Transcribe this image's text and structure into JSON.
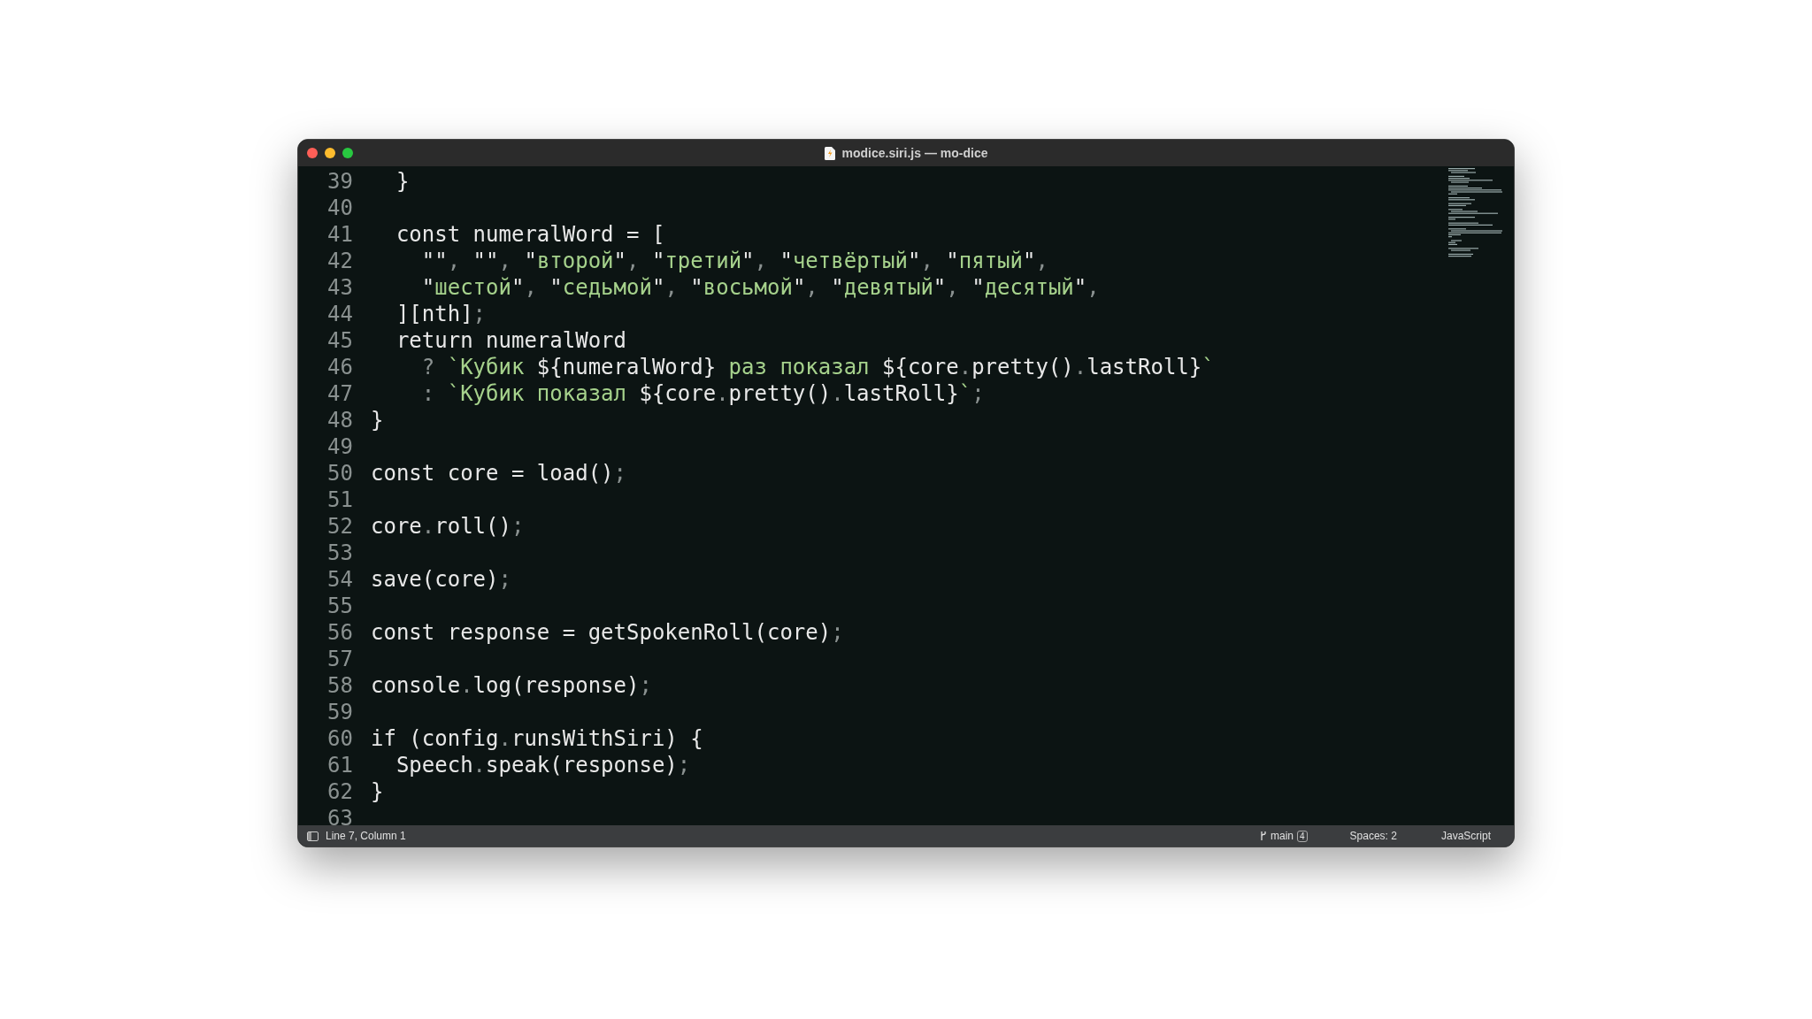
{
  "window": {
    "title": "modice.siri.js — mo-dice"
  },
  "editor": {
    "lines": [
      {
        "number": "39",
        "tokens": [
          {
            "kind": "plain",
            "text": "  }"
          }
        ]
      },
      {
        "number": "40"
      },
      {
        "number": "41",
        "tokens": [
          {
            "kind": "plain",
            "text": "  const numeralWord = ["
          }
        ]
      },
      {
        "number": "42",
        "tokens": [
          {
            "kind": "plain",
            "text": "    \"\""
          },
          {
            "kind": "punct",
            "text": ", "
          },
          {
            "kind": "plain",
            "text": "\"\""
          },
          {
            "kind": "punct",
            "text": ", "
          },
          {
            "kind": "plain",
            "text": "\""
          },
          {
            "kind": "string",
            "text": "второй"
          },
          {
            "kind": "plain",
            "text": "\""
          },
          {
            "kind": "punct",
            "text": ", "
          },
          {
            "kind": "plain",
            "text": "\""
          },
          {
            "kind": "string",
            "text": "третий"
          },
          {
            "kind": "plain",
            "text": "\""
          },
          {
            "kind": "punct",
            "text": ", "
          },
          {
            "kind": "plain",
            "text": "\""
          },
          {
            "kind": "string",
            "text": "четвёртый"
          },
          {
            "kind": "plain",
            "text": "\""
          },
          {
            "kind": "punct",
            "text": ", "
          },
          {
            "kind": "plain",
            "text": "\""
          },
          {
            "kind": "string",
            "text": "пятый"
          },
          {
            "kind": "plain",
            "text": "\""
          },
          {
            "kind": "punct",
            "text": ","
          }
        ]
      },
      {
        "number": "43",
        "tokens": [
          {
            "kind": "plain",
            "text": "    \""
          },
          {
            "kind": "string",
            "text": "шестой"
          },
          {
            "kind": "plain",
            "text": "\""
          },
          {
            "kind": "punct",
            "text": ", "
          },
          {
            "kind": "plain",
            "text": "\""
          },
          {
            "kind": "string",
            "text": "седьмой"
          },
          {
            "kind": "plain",
            "text": "\""
          },
          {
            "kind": "punct",
            "text": ", "
          },
          {
            "kind": "plain",
            "text": "\""
          },
          {
            "kind": "string",
            "text": "восьмой"
          },
          {
            "kind": "plain",
            "text": "\""
          },
          {
            "kind": "punct",
            "text": ", "
          },
          {
            "kind": "plain",
            "text": "\""
          },
          {
            "kind": "string",
            "text": "девятый"
          },
          {
            "kind": "plain",
            "text": "\""
          },
          {
            "kind": "punct",
            "text": ", "
          },
          {
            "kind": "plain",
            "text": "\""
          },
          {
            "kind": "string",
            "text": "десятый"
          },
          {
            "kind": "plain",
            "text": "\""
          },
          {
            "kind": "punct",
            "text": ","
          }
        ]
      },
      {
        "number": "44",
        "tokens": [
          {
            "kind": "plain",
            "text": "  ][nth]"
          },
          {
            "kind": "punct",
            "text": ";"
          }
        ]
      },
      {
        "number": "45",
        "tokens": [
          {
            "kind": "plain",
            "text": "  return numeralWord"
          }
        ]
      },
      {
        "number": "46",
        "tokens": [
          {
            "kind": "punct",
            "text": "    ? "
          },
          {
            "kind": "string",
            "text": "`Кубик "
          },
          {
            "kind": "plain",
            "text": "${numeralWord}"
          },
          {
            "kind": "string",
            "text": " раз показал "
          },
          {
            "kind": "plain",
            "text": "${core"
          },
          {
            "kind": "punct",
            "text": "."
          },
          {
            "kind": "plain",
            "text": "pretty()"
          },
          {
            "kind": "punct",
            "text": "."
          },
          {
            "kind": "plain",
            "text": "lastRoll}"
          },
          {
            "kind": "string",
            "text": "`"
          }
        ]
      },
      {
        "number": "47",
        "tokens": [
          {
            "kind": "punct",
            "text": "    : "
          },
          {
            "kind": "string",
            "text": "`Кубик показал "
          },
          {
            "kind": "plain",
            "text": "${core"
          },
          {
            "kind": "punct",
            "text": "."
          },
          {
            "kind": "plain",
            "text": "pretty()"
          },
          {
            "kind": "punct",
            "text": "."
          },
          {
            "kind": "plain",
            "text": "lastRoll}"
          },
          {
            "kind": "string",
            "text": "`"
          },
          {
            "kind": "punct",
            "text": ";"
          }
        ]
      },
      {
        "number": "48",
        "tokens": [
          {
            "kind": "plain",
            "text": "}"
          }
        ]
      },
      {
        "number": "49"
      },
      {
        "number": "50",
        "tokens": [
          {
            "kind": "plain",
            "text": "const core = load()"
          },
          {
            "kind": "punct",
            "text": ";"
          }
        ]
      },
      {
        "number": "51"
      },
      {
        "number": "52",
        "tokens": [
          {
            "kind": "plain",
            "text": "core"
          },
          {
            "kind": "punct",
            "text": "."
          },
          {
            "kind": "plain",
            "text": "roll()"
          },
          {
            "kind": "punct",
            "text": ";"
          }
        ]
      },
      {
        "number": "53"
      },
      {
        "number": "54",
        "tokens": [
          {
            "kind": "plain",
            "text": "save(core)"
          },
          {
            "kind": "punct",
            "text": ";"
          }
        ]
      },
      {
        "number": "55"
      },
      {
        "number": "56",
        "tokens": [
          {
            "kind": "plain",
            "text": "const response = getSpokenRoll(core)"
          },
          {
            "kind": "punct",
            "text": ";"
          }
        ]
      },
      {
        "number": "57"
      },
      {
        "number": "58",
        "tokens": [
          {
            "kind": "plain",
            "text": "console"
          },
          {
            "kind": "punct",
            "text": "."
          },
          {
            "kind": "plain",
            "text": "log(response)"
          },
          {
            "kind": "punct",
            "text": ";"
          }
        ]
      },
      {
        "number": "59"
      },
      {
        "number": "60",
        "tokens": [
          {
            "kind": "plain",
            "text": "if (config"
          },
          {
            "kind": "punct",
            "text": "."
          },
          {
            "kind": "plain",
            "text": "runsWithSiri) {"
          }
        ]
      },
      {
        "number": "61",
        "tokens": [
          {
            "kind": "plain",
            "text": "  Speech"
          },
          {
            "kind": "punct",
            "text": "."
          },
          {
            "kind": "plain",
            "text": "speak(response)"
          },
          {
            "kind": "punct",
            "text": ";"
          }
        ]
      },
      {
        "number": "62",
        "tokens": [
          {
            "kind": "plain",
            "text": "}"
          }
        ]
      },
      {
        "number": "63"
      }
    ]
  },
  "status_bar": {
    "position": "Line 7, Column 1",
    "branch": "main",
    "branch_count": "4",
    "indentation": "Spaces: 2",
    "language": "JavaScript"
  }
}
